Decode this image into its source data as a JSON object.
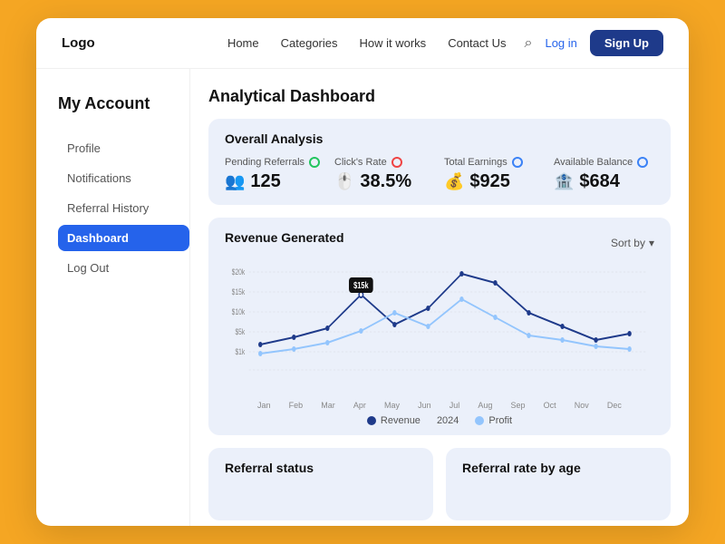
{
  "navbar": {
    "logo": "Logo",
    "links": [
      "Home",
      "Categories",
      "How it works",
      "Contact Us"
    ],
    "login_label": "Log in",
    "signup_label": "Sign Up"
  },
  "sidebar": {
    "title": "My Account",
    "items": [
      {
        "label": "Profile",
        "active": false
      },
      {
        "label": "Notifications",
        "active": false
      },
      {
        "label": "Referral History",
        "active": false
      },
      {
        "label": "Dashboard",
        "active": true
      },
      {
        "label": "Log Out",
        "active": false
      }
    ]
  },
  "content": {
    "page_title": "Analytical Dashboard",
    "overall_analysis": {
      "title": "Overall Analysis",
      "metrics": [
        {
          "label": "Pending Referrals",
          "dot": "green",
          "icon": "👥",
          "value": "125"
        },
        {
          "label": "Click's Rate",
          "dot": "red",
          "icon": "🖱️",
          "value": "38.5%"
        },
        {
          "label": "Total Earnings",
          "dot": "blue",
          "icon": "💰",
          "value": "$925"
        },
        {
          "label": "Available Balance",
          "dot": "blue",
          "icon": "🏦",
          "value": "$684"
        }
      ]
    },
    "revenue": {
      "title": "Revenue Generated",
      "sort_by": "Sort by",
      "tooltip_value": "$15k",
      "x_labels": [
        "Jan",
        "Feb",
        "Mar",
        "Apr",
        "May",
        "Jun",
        "Jul",
        "Aug",
        "Sep",
        "Oct",
        "Nov",
        "Dec"
      ],
      "y_labels": [
        "$20k",
        "$15k",
        "$10k",
        "$5k",
        "$1k"
      ],
      "legend": [
        {
          "label": "Revenue",
          "color": "dark-blue"
        },
        {
          "label": "2024",
          "color": "dark-blue"
        },
        {
          "label": "Profit",
          "color": "light-blue"
        }
      ]
    },
    "bottom_cards": [
      {
        "title": "Referral status"
      },
      {
        "title": "Referral rate by age"
      }
    ]
  }
}
